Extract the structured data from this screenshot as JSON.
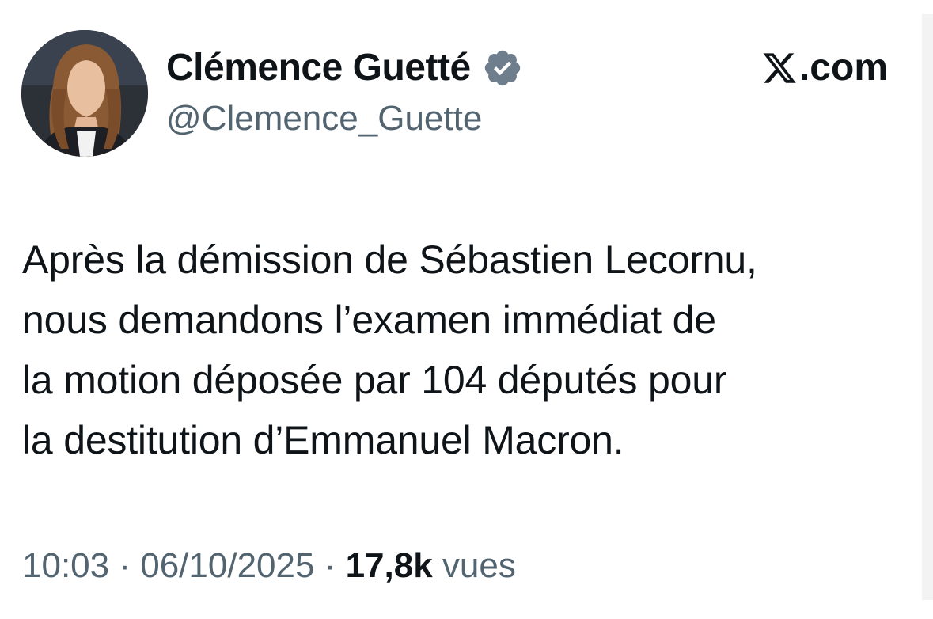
{
  "author": {
    "display_name": "Clémence Guetté",
    "handle": "@Clemence_Guette",
    "verified_icon": "verified-badge-icon"
  },
  "source": {
    "label": ".com",
    "icon": "x-logo-icon"
  },
  "tweet": {
    "lines": [
      "Après la démission de Sébastien Lecornu,",
      "nous demandons l’examen immédiat de",
      "la motion déposée par 104 députés pour",
      "la destitution d’Emmanuel Macron."
    ]
  },
  "meta": {
    "time": "10:03",
    "separator": "·",
    "date": "06/10/2025",
    "views_count": "17,8k",
    "views_label": "vues"
  },
  "colors": {
    "text": "#0f1419",
    "secondary": "#536471",
    "badge": "#6e7e8c"
  }
}
